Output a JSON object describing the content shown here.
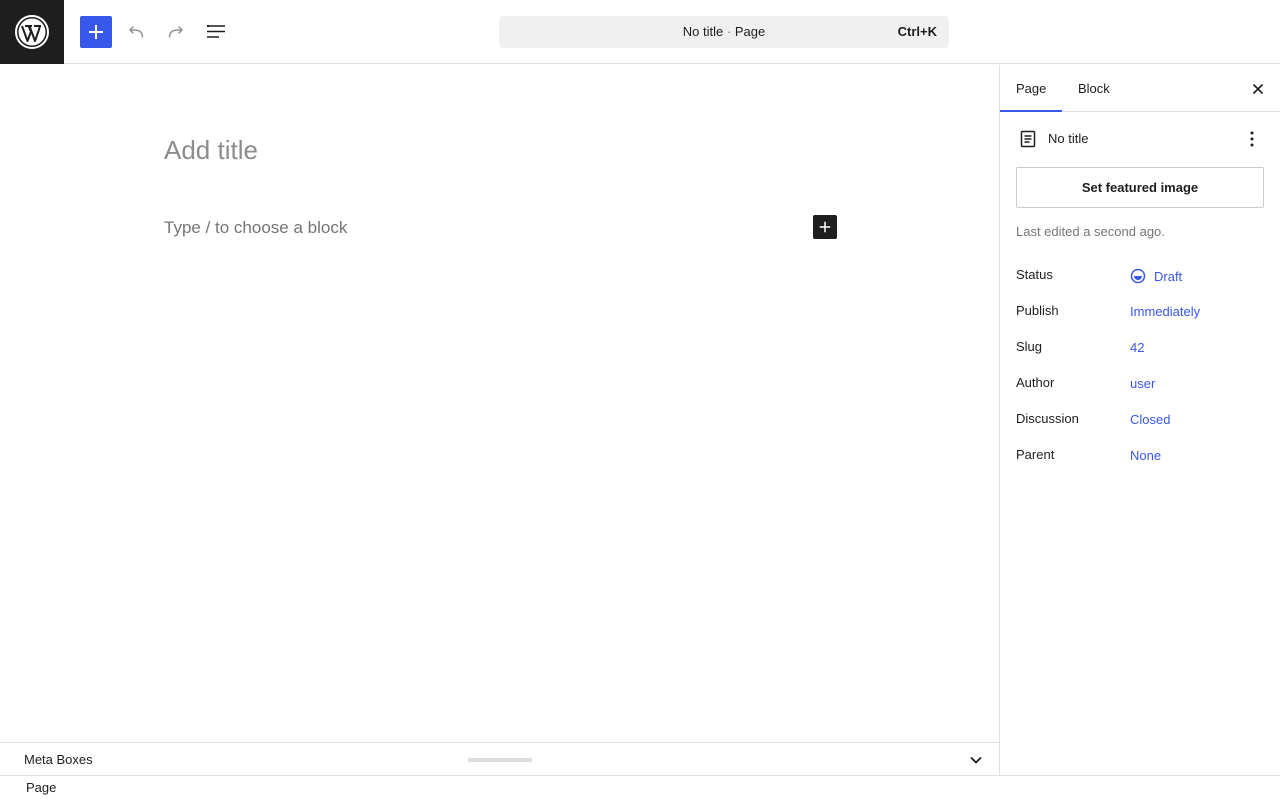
{
  "header": {
    "command_title": "No title",
    "command_separator": "·",
    "command_type": "Page",
    "command_shortcut": "Ctrl+K"
  },
  "editor": {
    "title_placeholder": "Add title",
    "block_placeholder": "Type / to choose a block"
  },
  "metaboxes": {
    "label": "Meta Boxes"
  },
  "footer": {
    "breadcrumb": "Page"
  },
  "sidebar": {
    "tabs": [
      {
        "label": "Page",
        "active": true
      },
      {
        "label": "Block",
        "active": false
      }
    ],
    "document_title": "No title",
    "featured_image_button": "Set featured image",
    "last_edited": "Last edited a second ago.",
    "properties": [
      {
        "label": "Status",
        "value": "Draft"
      },
      {
        "label": "Publish",
        "value": "Immediately"
      },
      {
        "label": "Slug",
        "value": "42"
      },
      {
        "label": "Author",
        "value": "user"
      },
      {
        "label": "Discussion",
        "value": "Closed"
      },
      {
        "label": "Parent",
        "value": "None"
      }
    ]
  },
  "colors": {
    "accent": "#3858e9",
    "dark": "#1e1e1e",
    "muted": "#757575"
  },
  "icons": [
    "wordpress-logo-icon",
    "plus-icon",
    "undo-icon",
    "redo-icon",
    "list-view-icon",
    "plus-icon",
    "chevron-down-icon",
    "close-icon",
    "page-icon",
    "more-vertical-icon",
    "draft-status-icon"
  ]
}
